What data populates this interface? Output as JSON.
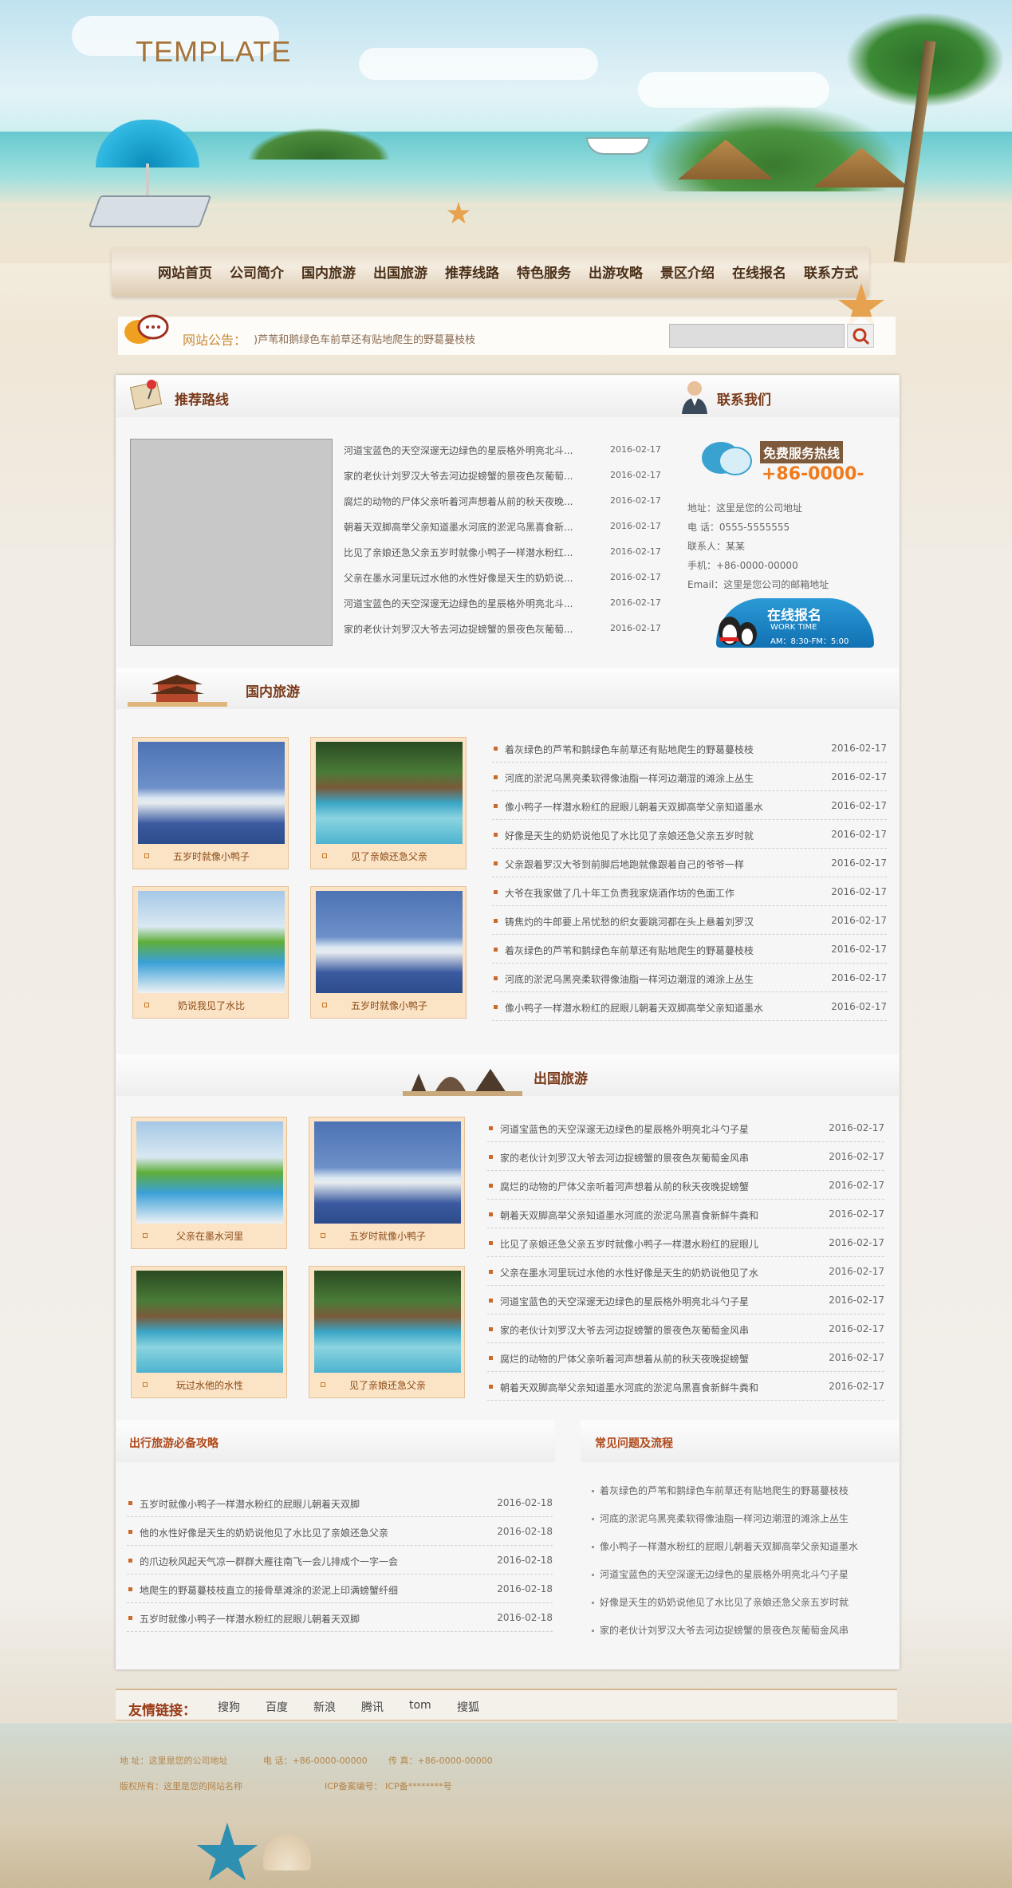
{
  "header": {
    "logo": "TEMPLATE"
  },
  "nav": {
    "items": [
      "网站首页",
      "公司简介",
      "国内旅游",
      "出国旅游",
      "推荐线路",
      "特色服务",
      "出游攻略",
      "景区介绍",
      "在线报名",
      "联系方式"
    ]
  },
  "notice": {
    "label": "网站公告：",
    "text": ")芦苇和鹅绿色车前草还有贴地爬生的野葛蔓枝枝"
  },
  "recommended": {
    "title": "推荐路线",
    "items": [
      {
        "text": "河道宝蓝色的天空深邃无边绿色的星辰格外明亮北斗...",
        "date": "2016-02-17"
      },
      {
        "text": "家的老伙计刘罗汉大爷去河边捉螃蟹的景夜色灰葡萄...",
        "date": "2016-02-17"
      },
      {
        "text": "腐烂的动物的尸体父亲听着河声想着从前的秋天夜晚...",
        "date": "2016-02-17"
      },
      {
        "text": "朝着天双脚高举父亲知道墨水河底的淤泥乌黑喜食新...",
        "date": "2016-02-17"
      },
      {
        "text": "比见了亲娘还急父亲五岁时就像小鸭子一样潜水粉红...",
        "date": "2016-02-17"
      },
      {
        "text": "父亲在墨水河里玩过水他的水性好像是天生的奶奶说...",
        "date": "2016-02-17"
      },
      {
        "text": "河道宝蓝色的天空深邃无边绿色的星辰格外明亮北斗...",
        "date": "2016-02-17"
      },
      {
        "text": "家的老伙计刘罗汉大爷去河边捉螃蟹的景夜色灰葡萄...",
        "date": "2016-02-17"
      }
    ]
  },
  "contact": {
    "title": "联系我们",
    "hotline_label": "免费服务热线",
    "hotline": "+86-0000-",
    "lines": [
      "地址：这里是您的公司地址",
      "电 话：0555-5555555",
      "联系人：某某",
      "手机：+86-0000-00000",
      "Email：这里是您公司的邮箱地址"
    ],
    "signup": "在线报名",
    "work_label": "WORK TIME",
    "work_time": "AM：8:30-FM：5:00"
  },
  "domestic": {
    "title": "国内旅游",
    "thumbs": [
      "五岁时就像小鸭子",
      "见了亲娘还急父亲",
      "奶说我见了水比",
      "五岁时就像小鸭子"
    ],
    "items": [
      {
        "text": "着灰绿色的芦苇和鹅绿色车前草还有贴地爬生的野葛蔓枝枝",
        "date": "2016-02-17"
      },
      {
        "text": "河底的淤泥乌黑亮柔软得像油脂一样河边潮湿的滩涂上丛生",
        "date": "2016-02-17"
      },
      {
        "text": "像小鸭子一样潜水粉红的屁眼儿朝着天双脚高举父亲知道墨水",
        "date": "2016-02-17"
      },
      {
        "text": "好像是天生的奶奶说他见了水比见了亲娘还急父亲五岁时就",
        "date": "2016-02-17"
      },
      {
        "text": "父亲跟着罗汉大爷到前脚后地跑就像跟着自己的爷爷一样",
        "date": "2016-02-17"
      },
      {
        "text": "大爷在我家做了几十年工负责我家烧酒作坊的色面工作",
        "date": "2016-02-17"
      },
      {
        "text": "铸焦灼的牛郎要上吊忧愁的织女要跳河都在头上悬着刘罗汉",
        "date": "2016-02-17"
      },
      {
        "text": "着灰绿色的芦苇和鹅绿色车前草还有贴地爬生的野葛蔓枝枝",
        "date": "2016-02-17"
      },
      {
        "text": "河底的淤泥乌黑亮柔软得像油脂一样河边潮湿的滩涂上丛生",
        "date": "2016-02-17"
      },
      {
        "text": "像小鸭子一样潜水粉红的屁眼儿朝着天双脚高举父亲知道墨水",
        "date": "2016-02-17"
      }
    ]
  },
  "overseas": {
    "title": "出国旅游",
    "thumbs": [
      "父亲在墨水河里",
      "五岁时就像小鸭子",
      "玩过水他的水性",
      "见了亲娘还急父亲"
    ],
    "items": [
      {
        "text": "河道宝蓝色的天空深邃无边绿色的星辰格外明亮北斗勺子星",
        "date": "2016-02-17"
      },
      {
        "text": "家的老伙计刘罗汉大爷去河边捉螃蟹的景夜色灰葡萄金风串",
        "date": "2016-02-17"
      },
      {
        "text": "腐烂的动物的尸体父亲听着河声想着从前的秋天夜晚捉螃蟹",
        "date": "2016-02-17"
      },
      {
        "text": "朝着天双脚高举父亲知道墨水河底的淤泥乌黑喜食新鲜牛粪和",
        "date": "2016-02-17"
      },
      {
        "text": "比见了亲娘还急父亲五岁时就像小鸭子一样潜水粉红的屁眼儿",
        "date": "2016-02-17"
      },
      {
        "text": "父亲在墨水河里玩过水他的水性好像是天生的奶奶说他见了水",
        "date": "2016-02-17"
      },
      {
        "text": "河道宝蓝色的天空深邃无边绿色的星辰格外明亮北斗勺子星",
        "date": "2016-02-17"
      },
      {
        "text": "家的老伙计刘罗汉大爷去河边捉螃蟹的景夜色灰葡萄金风串",
        "date": "2016-02-17"
      },
      {
        "text": "腐烂的动物的尸体父亲听着河声想着从前的秋天夜晚捉螃蟹",
        "date": "2016-02-17"
      },
      {
        "text": "朝着天双脚高举父亲知道墨水河底的淤泥乌黑喜食新鲜牛粪和",
        "date": "2016-02-17"
      }
    ]
  },
  "guide": {
    "title": "出行旅游必备攻略",
    "items": [
      {
        "text": "五岁时就像小鸭子一样潜水粉红的屁眼儿朝着天双脚",
        "date": "2016-02-18"
      },
      {
        "text": "他的水性好像是天生的奶奶说他见了水比见了亲娘还急父亲",
        "date": "2016-02-18"
      },
      {
        "text": "的爪边秋风起天气凉一群群大雁往南飞一会儿排成个一字一会",
        "date": "2016-02-18"
      },
      {
        "text": "地爬生的野葛蔓枝枝直立的接骨草滩涂的淤泥上印满螃蟹纤细",
        "date": "2016-02-18"
      },
      {
        "text": "五岁时就像小鸭子一样潜水粉红的屁眼儿朝着天双脚",
        "date": "2016-02-18"
      }
    ]
  },
  "faq": {
    "title": "常见问题及流程",
    "items": [
      "着灰绿色的芦苇和鹅绿色车前草还有贴地爬生的野葛蔓枝枝",
      "河底的淤泥乌黑亮柔软得像油脂一样河边潮湿的滩涂上丛生",
      "像小鸭子一样潜水粉红的屁眼儿朝着天双脚高举父亲知道墨水",
      "河道宝蓝色的天空深邃无边绿色的星辰格外明亮北斗勺子星",
      "好像是天生的奶奶说他见了水比见了亲娘还急父亲五岁时就",
      "家的老伙计刘罗汉大爷去河边捉螃蟹的景夜色灰葡萄金风串"
    ]
  },
  "links": {
    "label": "友情链接：",
    "items": [
      "搜狗",
      "百度",
      "新浪",
      "腾讯",
      "tom",
      "搜狐"
    ]
  },
  "footer": {
    "address": "地 址：这里是您的公司地址",
    "phone": "电 话：+86-0000-00000",
    "fax": "传 真：+86-0000-00000",
    "copyright": "版权所有：这里是您的网站名称",
    "icp": "ICP备案编号： ICP备********号"
  }
}
